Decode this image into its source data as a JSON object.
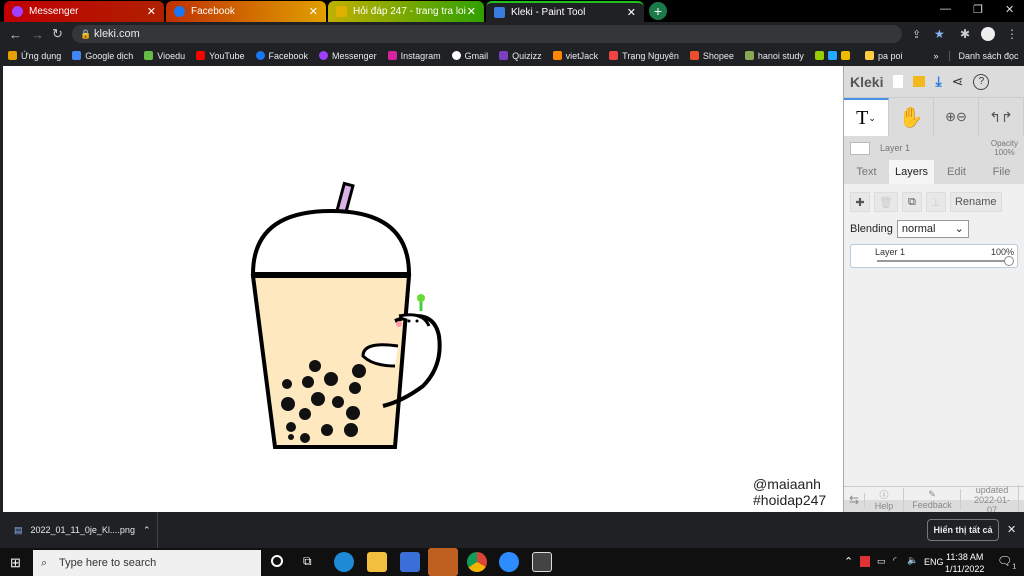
{
  "tabs": [
    {
      "title": "Messenger",
      "color": "#b00000"
    },
    {
      "title": "Facebook",
      "color": "#d06000"
    },
    {
      "title": "Hỏi đáp 247 - trang tra loi",
      "color": "#708000"
    },
    {
      "title": "Kleki - Paint Tool",
      "color": "#202124"
    }
  ],
  "url": "kleki.com",
  "bookmarks": [
    "Ứng dụng",
    "Google dịch",
    "Vioedu",
    "YouTube",
    "Facebook",
    "Messenger",
    "Instagram",
    "Gmail",
    "Quizizz",
    "vietJack",
    "Trạng Nguyên",
    "Shopee",
    "hanoi study",
    "pa poi"
  ],
  "reading_list": "Danh sách đọc",
  "canvas": {
    "signature_line1": "@maiaanh",
    "signature_line2": "#hoidap247"
  },
  "panel": {
    "logo": "Kleki",
    "layer_name": "Layer 1",
    "opacity_label": "Opacity",
    "opacity_value": "100%",
    "tabs": [
      "Text",
      "Layers",
      "Edit",
      "File"
    ],
    "rename": "Rename",
    "blending_label": "Blending",
    "blending_value": "normal",
    "layer_item": "Layer 1",
    "layer_opacity": "100%",
    "help": "Help",
    "feedback": "Feedback",
    "updated_label": "updated",
    "updated_date": "2022-01-07"
  },
  "download": {
    "file": "2022_01_11_0je_Kl....png",
    "show_all": "Hiển thị tất cả"
  },
  "taskbar": {
    "search_placeholder": "Type here to search",
    "lang": "ENG",
    "time": "11:38 AM",
    "date": "1/11/2022",
    "notif": "1"
  }
}
